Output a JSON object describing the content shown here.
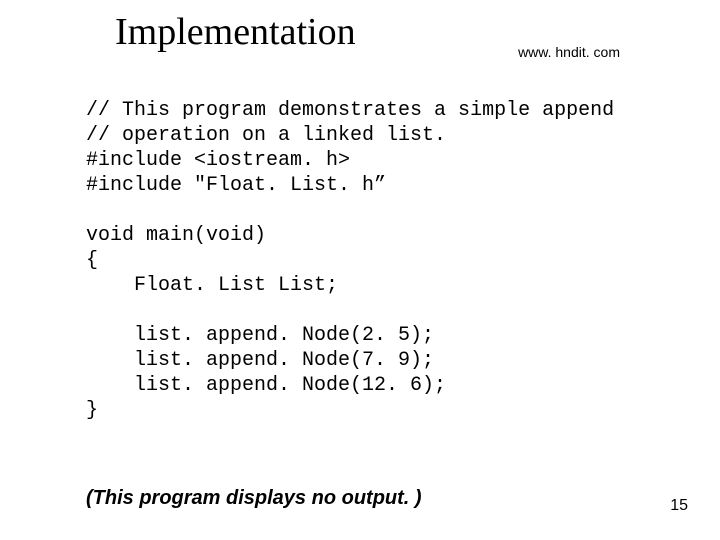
{
  "title": "Implementation",
  "url": "www. hndit. com",
  "code": "// This program demonstrates a simple append\n// operation on a linked list.\n#include <iostream. h>\n#include \"Float. List. h”\n\nvoid main(void)\n{\n    Float. List List;\n\n    list. append. Node(2. 5);\n    list. append. Node(7. 9);\n    list. append. Node(12. 6);\n}",
  "note": "(This program displays no output. )",
  "pagenum": "15"
}
